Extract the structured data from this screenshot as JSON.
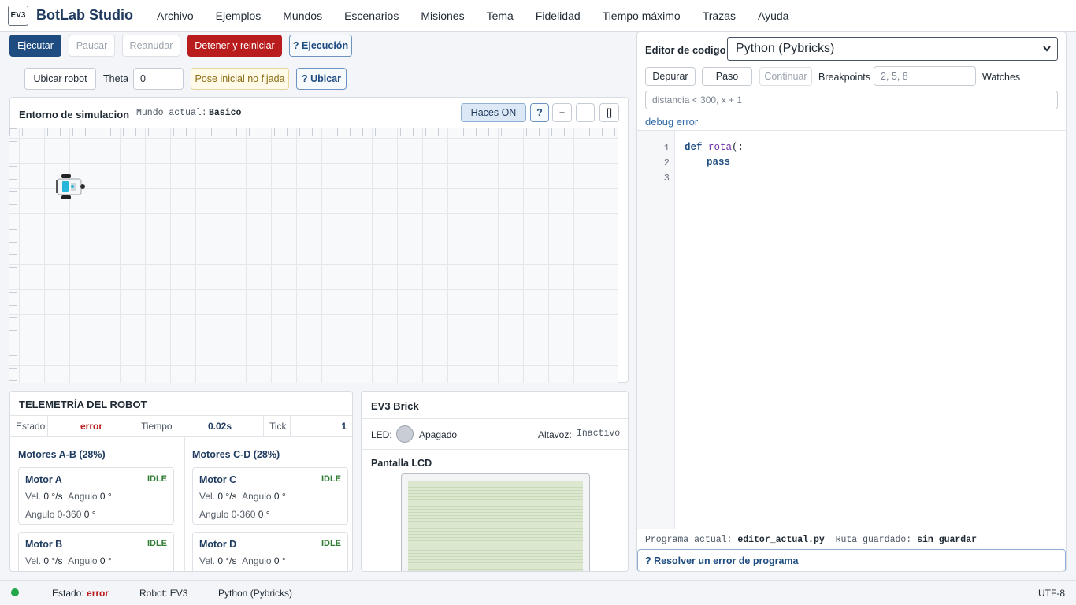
{
  "app": {
    "logo": "EV3",
    "title": "BotLab Studio"
  },
  "menu": [
    "Archivo",
    "Ejemplos",
    "Mundos",
    "Escenarios",
    "Misiones",
    "Tema",
    "Fidelidad",
    "Tiempo máximo",
    "Trazas",
    "Ayuda"
  ],
  "toolbar": {
    "run": "Ejecutar",
    "pause": "Pausar",
    "resume": "Reanudar",
    "stop": "Detener y reiniciar",
    "help_exec": "? Ejecución",
    "locate": "Ubicar robot",
    "theta_label": "Theta",
    "theta_value": "0",
    "pose_status": "Pose inicial no fijada",
    "help_locate": "? Ubicar"
  },
  "sim": {
    "title": "Entorno de simulacion",
    "world_label": "Mundo actual:",
    "world_value": "Basico",
    "beams_btn": "Haces ON",
    "help_btn": "?",
    "zoom_in": "+",
    "zoom_out": "-",
    "fit_btn": "[]"
  },
  "telemetry": {
    "title": "TELEMETRÍA DEL ROBOT",
    "state_label": "Estado",
    "state_value": "error",
    "time_label": "Tiempo",
    "time_value": "0.02s",
    "tick_label": "Tick",
    "tick_value": "1",
    "group_ab": "Motores A-B (28%)",
    "group_cd": "Motores C-D (28%)",
    "motors": [
      {
        "name": "Motor A",
        "state": "IDLE",
        "vel_label": "Vel.",
        "vel": "0 °/s",
        "ang_label": "Angulo",
        "ang": "0 °",
        "ang360_label": "Angulo 0-360",
        "ang360": "0 °"
      },
      {
        "name": "Motor B",
        "state": "IDLE",
        "vel_label": "Vel.",
        "vel": "0 °/s",
        "ang_label": "Angulo",
        "ang": "0 °"
      },
      {
        "name": "Motor C",
        "state": "IDLE",
        "vel_label": "Vel.",
        "vel": "0 °/s",
        "ang_label": "Angulo",
        "ang": "0 °",
        "ang360_label": "Angulo 0-360",
        "ang360": "0 °"
      },
      {
        "name": "Motor D",
        "state": "IDLE",
        "vel_label": "Vel.",
        "vel": "0 °/s",
        "ang_label": "Angulo",
        "ang": "0 °"
      }
    ]
  },
  "brick": {
    "title": "EV3 Brick",
    "led_label": "LED:",
    "led_value": "Apagado",
    "speaker_label": "Altavoz:",
    "speaker_value": "Inactivo",
    "lcd_title": "Pantalla LCD"
  },
  "editor": {
    "title": "Editor de codigo",
    "language": "Python (Pybricks)",
    "debug_btn": "Depurar",
    "step_btn": "Paso",
    "continue_btn": "Continuar",
    "breakpoints_label": "Breakpoints",
    "breakpoints_placeholder": "2, 5, 8",
    "watches_label": "Watches",
    "watches_placeholder": "distancia < 300, x + 1",
    "debug_status": "debug error",
    "lines": [
      "1",
      "2",
      "3"
    ],
    "code": {
      "kw_def": "def",
      "fn_name": "rota",
      "rest": "(:",
      "pass": "pass"
    },
    "program_label": "Programa actual:",
    "program_value": "editor_actual.py",
    "path_label": "Ruta guardado:",
    "path_value": "sin guardar",
    "resolve_btn": "? Resolver un error de programa"
  },
  "status": {
    "state_label": "Estado:",
    "state_value": "error",
    "robot": "Robot: EV3",
    "language": "Python (Pybricks)",
    "encoding": "UTF-8"
  },
  "colors": {
    "accent": "#1e4c80",
    "danger": "#b91c1c",
    "ok": "#22a64a",
    "lcd": "#dce7cf"
  }
}
